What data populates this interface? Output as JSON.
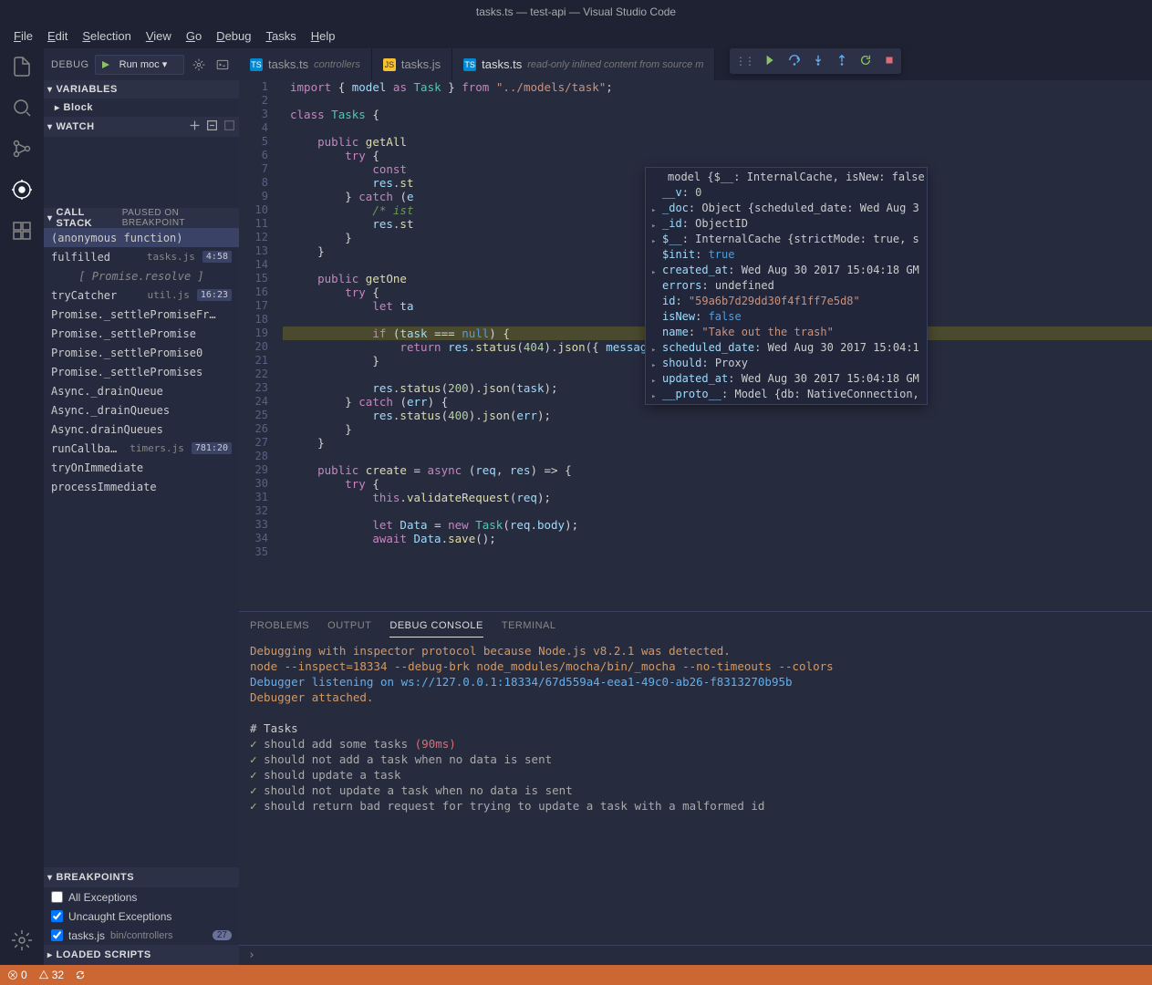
{
  "title": "tasks.ts — test-api — Visual Studio Code",
  "menu": [
    "File",
    "Edit",
    "Selection",
    "View",
    "Go",
    "Debug",
    "Tasks",
    "Help"
  ],
  "debug": {
    "label": "DEBUG",
    "config": "Run moc ▾"
  },
  "sections": {
    "variables": "VARIABLES",
    "block": "Block",
    "watch": "WATCH",
    "callstack": "CALL STACK",
    "callstack_status": "PAUSED ON BREAKPOINT",
    "breakpoints": "BREAKPOINTS",
    "loaded_scripts": "LOADED SCRIPTS"
  },
  "callstack": [
    {
      "name": "(anonymous function)",
      "file": "",
      "line": "",
      "selected": true
    },
    {
      "name": "fulfilled",
      "file": "tasks.js",
      "line": "4:58"
    },
    {
      "name": "[ Promise.resolve ]",
      "special": true
    },
    {
      "name": "tryCatcher",
      "file": "util.js",
      "line": "16:23"
    },
    {
      "name": "Promise._settlePromiseFr…",
      "file": "",
      "line": ""
    },
    {
      "name": "Promise._settlePromise",
      "file": "",
      "line": ""
    },
    {
      "name": "Promise._settlePromise0",
      "file": "",
      "line": ""
    },
    {
      "name": "Promise._settlePromises",
      "file": "",
      "line": ""
    },
    {
      "name": "Async._drainQueue",
      "file": "",
      "line": ""
    },
    {
      "name": "Async._drainQueues",
      "file": "",
      "line": ""
    },
    {
      "name": "Async.drainQueues",
      "file": "",
      "line": ""
    },
    {
      "name": "runCallback",
      "file": "timers.js",
      "line": "781:20"
    },
    {
      "name": "tryOnImmediate",
      "file": "",
      "line": ""
    },
    {
      "name": "processImmediate",
      "file": "",
      "line": ""
    }
  ],
  "breakpoints": [
    {
      "checked": false,
      "label": "All Exceptions"
    },
    {
      "checked": true,
      "label": "Uncaught Exceptions"
    },
    {
      "checked": true,
      "label": "tasks.js",
      "path": "bin/controllers",
      "badge": "27"
    }
  ],
  "tabs": [
    {
      "icon": "ts",
      "label": "tasks.ts",
      "desc": "controllers"
    },
    {
      "icon": "js",
      "label": "tasks.js",
      "desc": ""
    },
    {
      "icon": "ts",
      "label": "tasks.ts",
      "desc": "read-only inlined content from source m",
      "active": true
    }
  ],
  "hover": {
    "header": "model {$__: InternalCache, isNew: false,",
    "rows": [
      {
        "exp": false,
        "key": "__v",
        "val": "0",
        "type": "n"
      },
      {
        "exp": true,
        "key": "_doc",
        "val": "Object {scheduled_date: Wed Aug 3",
        "type": "o"
      },
      {
        "exp": true,
        "key": "_id",
        "val": "ObjectID",
        "type": "o"
      },
      {
        "exp": true,
        "key": "$__",
        "val": "InternalCache {strictMode: true, s",
        "type": "o"
      },
      {
        "exp": false,
        "key": "$init",
        "val": "true",
        "type": "b"
      },
      {
        "exp": true,
        "key": "created_at",
        "val": "Wed Aug 30 2017 15:04:18 GM",
        "type": "o"
      },
      {
        "exp": false,
        "key": "errors",
        "val": "undefined",
        "type": "o"
      },
      {
        "exp": false,
        "key": "id",
        "val": "\"59a6b7d29dd30f4f1ff7e5d8\"",
        "type": "s"
      },
      {
        "exp": false,
        "key": "isNew",
        "val": "false",
        "type": "b"
      },
      {
        "exp": false,
        "key": "name",
        "val": "\"Take out the trash\"",
        "type": "s"
      },
      {
        "exp": true,
        "key": "scheduled_date",
        "val": "Wed Aug 30 2017 15:04:1",
        "type": "o"
      },
      {
        "exp": true,
        "key": "should",
        "val": "Proxy",
        "type": "o"
      },
      {
        "exp": true,
        "key": "updated_at",
        "val": "Wed Aug 30 2017 15:04:18 GM",
        "type": "o"
      },
      {
        "exp": true,
        "key": "__proto__",
        "val": "Model {db: NativeConnection,",
        "type": "o"
      }
    ]
  },
  "panel_tabs": [
    "PROBLEMS",
    "OUTPUT",
    "DEBUG CONSOLE",
    "TERMINAL"
  ],
  "console": {
    "l1": "Debugging with inspector protocol because Node.js v8.2.1 was detected.",
    "l2": "node --inspect=18334 --debug-brk node_modules/mocha/bin/_mocha --no-timeouts --colors",
    "l3": "Debugger listening on ws://127.0.0.1:18334/67d559a4-eea1-49c0-ab26-f8313270b95b",
    "l4": "Debugger attached.",
    "heading": "# Tasks",
    "tests": [
      {
        "pass": true,
        "text": "should add some tasks",
        "time": "(90ms)"
      },
      {
        "pass": true,
        "text": "should not add a task when no data is sent"
      },
      {
        "pass": true,
        "text": "should update a task"
      },
      {
        "pass": true,
        "text": "should not update a task when no data is sent"
      },
      {
        "pass": true,
        "text": "should return bad request for trying to update a task with a malformed id"
      }
    ]
  },
  "status": {
    "errors": "0",
    "warnings": "32"
  }
}
